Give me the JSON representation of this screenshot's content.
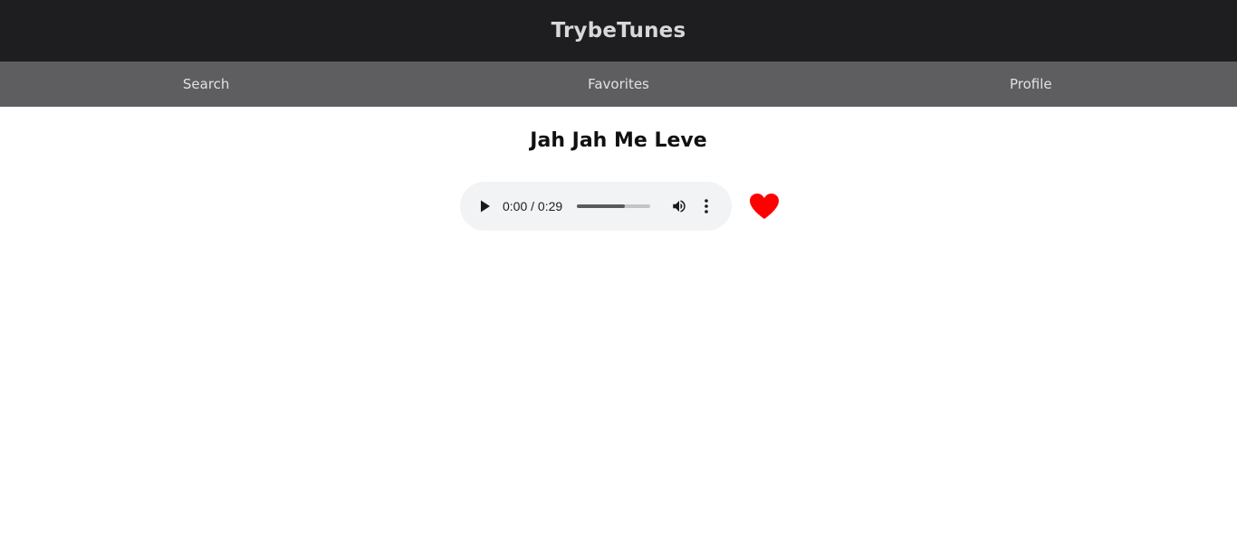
{
  "header": {
    "title": "TrybeTunes"
  },
  "nav": {
    "items": [
      {
        "label": "Search"
      },
      {
        "label": "Favorites"
      },
      {
        "label": "Profile"
      }
    ]
  },
  "track": {
    "title": "Jah Jah Me Leve",
    "player": {
      "time_text": "0:00 / 0:29",
      "progress_fraction": 0.65,
      "play_icon": "play-icon",
      "volume_icon": "volume-icon",
      "more_icon": "more-vertical-icon"
    },
    "favorite": {
      "checked": true,
      "icon": "heart-icon",
      "color": "#ff0000"
    }
  },
  "colors": {
    "header_bg": "#1e1e20",
    "nav_bg": "#5e5e60",
    "player_bg": "#f1f3f4"
  }
}
